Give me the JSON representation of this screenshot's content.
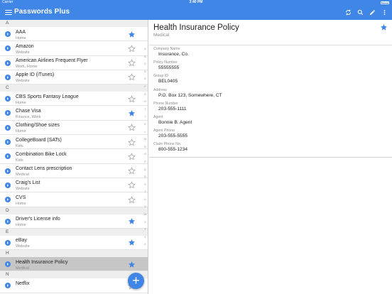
{
  "status_bar": {
    "carrier": "Carrier",
    "time": "3:40 PM"
  },
  "app": {
    "title": "Passwords Plus"
  },
  "colors": {
    "accent": "#3f86e6",
    "star_on": "#3f86e6",
    "star_off": "#9e9e9e",
    "selected_row": "#c6c6c6"
  },
  "toolbar": {
    "icons": [
      "sync-icon",
      "search-icon",
      "edit-icon",
      "more-vert-icon"
    ]
  },
  "list": [
    {
      "header": "A"
    },
    {
      "name": "AAA",
      "category": "Home",
      "starred": true
    },
    {
      "name": "Amazon",
      "category": "Website",
      "starred": false
    },
    {
      "name": "American Airlines Frequent Flyer",
      "category": "Work, Home",
      "starred": false
    },
    {
      "name": "Apple ID (iTunes)",
      "category": "Website",
      "starred": false
    },
    {
      "header": "C"
    },
    {
      "name": "CBS Sports Fantasy League",
      "category": "Home",
      "starred": false
    },
    {
      "name": "Chase Visa",
      "category": "Finance, Work",
      "starred": true
    },
    {
      "name": "Clothing/Shoe sizes",
      "category": "Home",
      "starred": false
    },
    {
      "name": "CollegeBoard (SATs)",
      "category": "Kids",
      "starred": false
    },
    {
      "name": "Combination Bike Lock",
      "category": "Kids",
      "starred": false
    },
    {
      "name": "Contact Lens prescription",
      "category": "Medical",
      "starred": false
    },
    {
      "name": "Craig's List",
      "category": "Website",
      "starred": false
    },
    {
      "name": "CVS",
      "category": "Home",
      "starred": false
    },
    {
      "header": "D"
    },
    {
      "name": "Driver's License info",
      "category": "Home",
      "starred": true
    },
    {
      "header": "E"
    },
    {
      "name": "eBay",
      "category": "Website",
      "starred": true
    },
    {
      "header": "H"
    },
    {
      "name": "Health Insurance Policy",
      "category": "Medical",
      "starred": true,
      "selected": true
    },
    {
      "header": "N"
    },
    {
      "name": "Netflix",
      "category": "",
      "starred": false
    }
  ],
  "index_letters": [
    "A",
    "B",
    "C",
    "D",
    "E",
    "F",
    "G",
    "H",
    "I",
    "J",
    "K",
    "L",
    "M",
    "N",
    "O",
    "P",
    "Q",
    "R",
    "S",
    "T",
    "U",
    "V",
    "W",
    "X",
    "Y",
    "Z",
    "#"
  ],
  "detail": {
    "title": "Health Insurance Policy",
    "subtitle": "Medical",
    "starred": true,
    "fields": [
      {
        "label": "Company Name",
        "value": "Insurance, Co."
      },
      {
        "label": "Policy Number",
        "value": "55555555"
      },
      {
        "label": "Group ID",
        "value": "BEL0405"
      },
      {
        "label": "Address",
        "value": "P.O. Box 123, Somewhere, CT"
      },
      {
        "label": "Phone Number",
        "value": "203-555-1111"
      },
      {
        "label": "Agent",
        "value": "Bonnie B. Agent"
      },
      {
        "label": "Agent Phone",
        "value": "203-555-5555"
      },
      {
        "label": "Claim Phone No.",
        "value": "800-555-1234"
      }
    ]
  },
  "fab": {
    "label": "+"
  }
}
